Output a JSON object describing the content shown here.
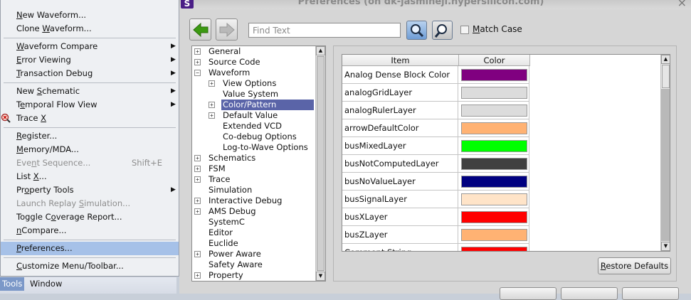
{
  "window": {
    "title": "Preferences (on dk-jasmineji.hypersilicon.com)",
    "app_icon_glyph": "S",
    "close_glyph": "×"
  },
  "toolbar": {
    "back_icon": "left-arrow-icon",
    "forward_icon": "right-arrow-icon",
    "find_placeholder": "Find Text",
    "find_icon": "search-icon",
    "find_next_icon": "search-next-icon",
    "match_case_label": "Match Case",
    "match_case_checked": false,
    "accent_green": "#3c9a12"
  },
  "tree": {
    "items": [
      {
        "label": "General",
        "level": 0,
        "expander": "+"
      },
      {
        "label": "Source Code",
        "level": 0,
        "expander": "+"
      },
      {
        "label": "Waveform",
        "level": 0,
        "expander": "-"
      },
      {
        "label": "View Options",
        "level": 1,
        "expander": "+"
      },
      {
        "label": "Value System",
        "level": 1,
        "expander": ""
      },
      {
        "label": "Color/Pattern",
        "level": 1,
        "expander": "+",
        "selected": true
      },
      {
        "label": "Default Value",
        "level": 1,
        "expander": "+"
      },
      {
        "label": "Extended VCD",
        "level": 1,
        "expander": ""
      },
      {
        "label": "Co-debug Options",
        "level": 1,
        "expander": ""
      },
      {
        "label": "Log-to-Wave Options",
        "level": 1,
        "expander": ""
      },
      {
        "label": "Schematics",
        "level": 0,
        "expander": "+"
      },
      {
        "label": "FSM",
        "level": 0,
        "expander": "+"
      },
      {
        "label": "Trace",
        "level": 0,
        "expander": "+"
      },
      {
        "label": "Simulation",
        "level": 0,
        "expander": ""
      },
      {
        "label": "Interactive Debug",
        "level": 0,
        "expander": "+"
      },
      {
        "label": "AMS Debug",
        "level": 0,
        "expander": "+"
      },
      {
        "label": "SystemC",
        "level": 0,
        "expander": ""
      },
      {
        "label": "Editor",
        "level": 0,
        "expander": ""
      },
      {
        "label": "Euclide",
        "level": 0,
        "expander": ""
      },
      {
        "label": "Power Aware",
        "level": 0,
        "expander": "+"
      },
      {
        "label": "Safety Aware",
        "level": 0,
        "expander": ""
      },
      {
        "label": "Property",
        "level": 0,
        "expander": "+"
      }
    ],
    "selected_color": "#5a64a8"
  },
  "grid": {
    "columns": [
      "Item",
      "Color"
    ],
    "rows": [
      {
        "item": "Analog Dense Block Color",
        "color": "#800080"
      },
      {
        "item": "analogGridLayer",
        "color": "#dcdcdc"
      },
      {
        "item": "analogRulerLayer",
        "color": "#dcdcdc"
      },
      {
        "item": "arrowDefaultColor",
        "color": "#ffb273"
      },
      {
        "item": "busMixedLayer",
        "color": "#00ff00"
      },
      {
        "item": "busNotComputedLayer",
        "color": "#404040"
      },
      {
        "item": "busNoValueLayer",
        "color": "#000080"
      },
      {
        "item": "busSignalLayer",
        "color": "#ffe4c8"
      },
      {
        "item": "busXLayer",
        "color": "#ff0000"
      },
      {
        "item": "busZLayer",
        "color": "#ffb273"
      },
      {
        "item": "Comment String",
        "color": "#ff0000"
      }
    ],
    "restore_defaults_label": "Restore Defaults"
  },
  "tools_menu": {
    "items": [
      {
        "label": "New Waveform...",
        "type": "item"
      },
      {
        "label": "Clone Waveform...",
        "type": "item"
      },
      {
        "type": "separator"
      },
      {
        "label": "Waveform Compare",
        "type": "submenu"
      },
      {
        "label": "Error Viewing",
        "type": "submenu"
      },
      {
        "label": "Transaction Debug",
        "type": "submenu"
      },
      {
        "type": "separator"
      },
      {
        "label": "New Schematic",
        "type": "submenu"
      },
      {
        "label": "Temporal Flow View",
        "type": "submenu"
      },
      {
        "label": "Trace X",
        "type": "item",
        "icon": "trace-x-icon"
      },
      {
        "type": "separator"
      },
      {
        "label": "Register...",
        "type": "item"
      },
      {
        "label": "Memory/MDA...",
        "type": "item"
      },
      {
        "label": "Event Sequence...",
        "type": "item",
        "disabled": true,
        "shortcut": "Shift+E"
      },
      {
        "label": "List X...",
        "type": "item"
      },
      {
        "label": "Property Tools",
        "type": "submenu"
      },
      {
        "label": "Launch Replay Simulation...",
        "type": "item",
        "disabled": true
      },
      {
        "label": "Toggle Coverage Report...",
        "type": "item"
      },
      {
        "label": "nCompare...",
        "type": "item"
      },
      {
        "type": "separator"
      },
      {
        "label": "Preferences...",
        "type": "item",
        "highlight": true
      },
      {
        "type": "separator"
      },
      {
        "label": "Customize Menu/Toolbar...",
        "type": "item"
      }
    ],
    "highlight_color": "#a6c1e8"
  },
  "menubar": {
    "tools_label": "Tools",
    "window_label": "Window"
  }
}
